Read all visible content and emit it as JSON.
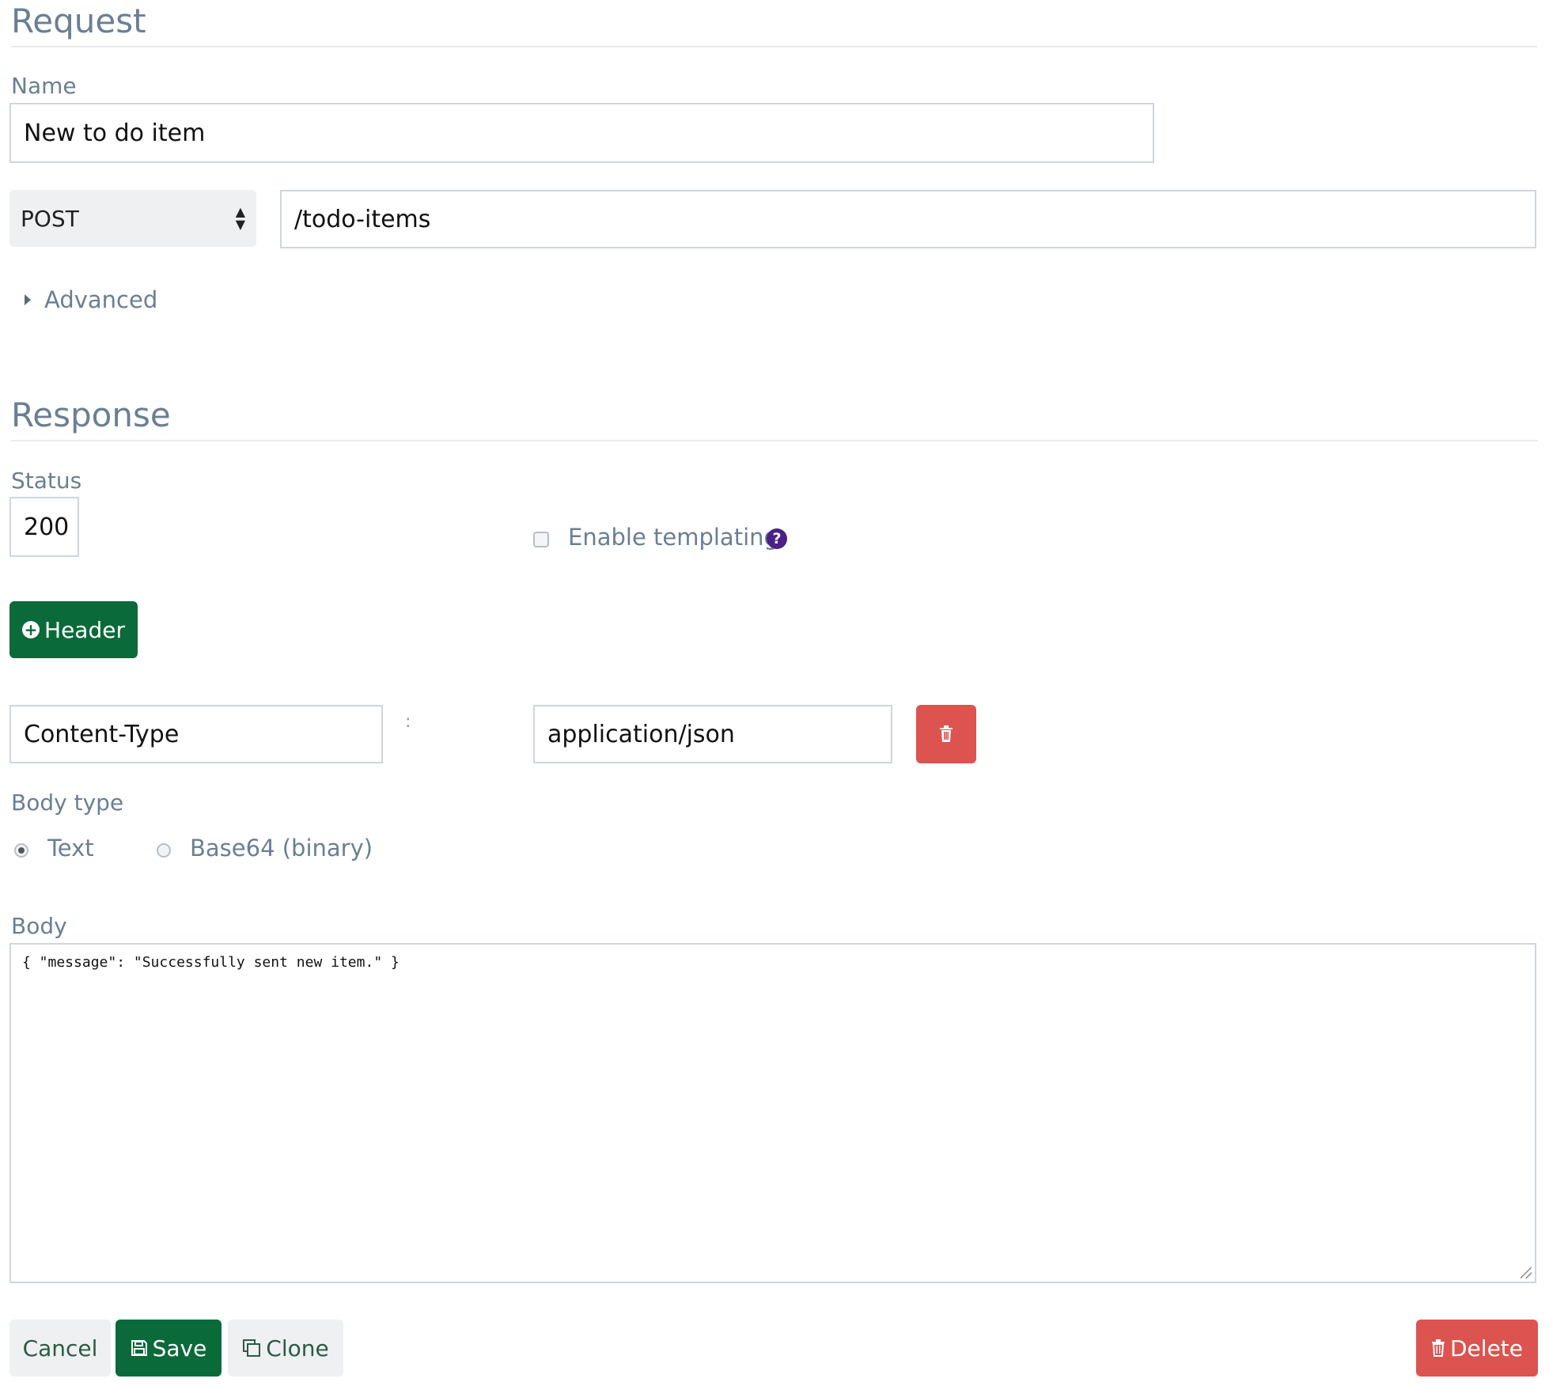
{
  "request": {
    "title": "Request",
    "name_label": "Name",
    "name_value": "New to do item",
    "method": "POST",
    "path": "/todo-items",
    "advanced_label": "Advanced"
  },
  "response": {
    "title": "Response",
    "status_label": "Status",
    "status_value": "200",
    "templating_label": "Enable templating",
    "help_icon_glyph": "?",
    "header_button_label": "Header",
    "header_name": "Content-Type",
    "header_separator": ":",
    "header_value": "application/json",
    "body_type_label": "Body type",
    "body_type_options": [
      "Text",
      "Base64 (binary)"
    ],
    "body_type_selected": "Text",
    "body_label": "Body",
    "body_value": "{ \"message\": \"Successfully sent new item.\" }"
  },
  "actions": {
    "cancel": "Cancel",
    "save": "Save",
    "clone": "Clone",
    "delete": "Delete"
  },
  "colors": {
    "primary_green": "#0b6a3a",
    "danger_red": "#dc534f",
    "help_purple": "#4b2088",
    "label_gray": "#6a7f94"
  },
  "icons": {
    "header_button": "plus-circle-icon",
    "delete_header": "trash-icon",
    "save": "floppy-disk-icon",
    "clone": "copy-icon",
    "delete": "trash-icon",
    "advanced": "caret-right-icon",
    "help": "question-circle-icon"
  }
}
